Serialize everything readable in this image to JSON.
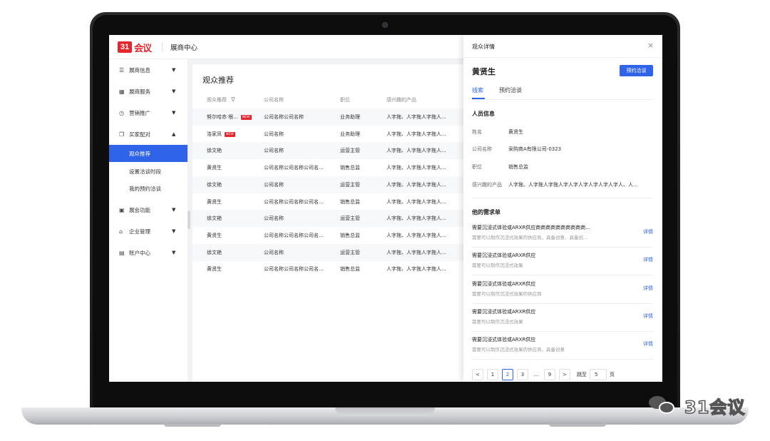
{
  "header": {
    "logo_mark": "31",
    "logo_text": "会议",
    "title": "展商中心"
  },
  "sidebar": {
    "items": [
      {
        "icon": "info-card-icon",
        "glyph": "☰",
        "label": "展商信息",
        "caret": "▼"
      },
      {
        "icon": "grid-icon",
        "glyph": "▦",
        "label": "展商服务",
        "caret": "▼"
      },
      {
        "icon": "clock-icon",
        "glyph": "◷",
        "label": "营销推广",
        "caret": "▼"
      },
      {
        "icon": "copy-icon",
        "glyph": "❐",
        "label": "买家配对",
        "caret": "▲"
      },
      {
        "icon": "meeting-icon",
        "glyph": "▣",
        "label": "展会功能",
        "caret": "▼"
      },
      {
        "icon": "building-icon",
        "glyph": "⌂",
        "label": "企业管理",
        "caret": "▼"
      },
      {
        "icon": "account-icon",
        "glyph": "▤",
        "label": "账户中心",
        "caret": "▼"
      }
    ],
    "sub_items": [
      {
        "label": "观众推荐",
        "active": true
      },
      {
        "label": "设置洽谈时段",
        "active": false
      },
      {
        "label": "我的预约洽谈",
        "active": false
      }
    ]
  },
  "main": {
    "title": "观众推荐",
    "columns": [
      "观众推荐",
      "公司名称",
      "职位",
      "感兴趣的产品"
    ],
    "filter_icon": "∇",
    "new_badge": "NEW",
    "rows": [
      {
        "name": "努尔哈赤·根...",
        "company": "公司名称公司名称",
        "title": "业务助理",
        "interest": "人字拖、人字拖人字拖人...",
        "new": true
      },
      {
        "name": "洛家凤",
        "company": "公司名称",
        "title": "业务助理",
        "interest": "人字拖、人字拖人字拖人...",
        "new": true
      },
      {
        "name": "徐文艳",
        "company": "公司名称",
        "title": "运营主管",
        "interest": "人字拖、人字拖人字拖人...",
        "new": false
      },
      {
        "name": "黄贤生",
        "company": "公司名称公司名称公司名...",
        "title": "销售总监",
        "interest": "人字拖、人字拖人字拖人...",
        "new": false
      },
      {
        "name": "徐文艳",
        "company": "公司名称",
        "title": "运营主管",
        "interest": "人字拖、人字拖人字拖人...",
        "new": false
      },
      {
        "name": "黄贤生",
        "company": "公司名称公司名称公司名...",
        "title": "销售总监",
        "interest": "人字拖、人字拖人字拖人...",
        "new": false
      },
      {
        "name": "徐文艳",
        "company": "公司名称",
        "title": "运营主管",
        "interest": "人字拖、人字拖人字拖人...",
        "new": false
      },
      {
        "name": "黄贤生",
        "company": "公司名称公司名称公司名...",
        "title": "销售总监",
        "interest": "人字拖、人字拖人字拖人...",
        "new": false
      },
      {
        "name": "徐文艳",
        "company": "公司名称",
        "title": "运营主管",
        "interest": "人字拖、人字拖人字拖人...",
        "new": false
      },
      {
        "name": "黄贤生",
        "company": "公司名称公司名称公司名...",
        "title": "销售总监",
        "interest": "人字拖、人字拖人字拖人...",
        "new": false
      }
    ]
  },
  "drawer": {
    "title": "观众详情",
    "close": "×",
    "name": "黄贤生",
    "book_button": "预约洽谈",
    "tabs": [
      {
        "label": "线索",
        "active": true
      },
      {
        "label": "预约洽谈",
        "active": false
      }
    ],
    "info_title": "人员信息",
    "info": [
      {
        "k": "姓名",
        "v": "黄贤生"
      },
      {
        "k": "公司名称",
        "v": "采购商A有限公司-0323"
      },
      {
        "k": "职位",
        "v": "销售总监"
      },
      {
        "k": "感兴趣的产品",
        "v": "人字拖、人字拖人字拖人字人字人字人字人字人字人、人..."
      }
    ],
    "needs_title": "他的需求单",
    "needs": [
      {
        "title": "需要沉浸式体验或ARXR供应商商商商商商商商商商...",
        "desc": "需要可以制作沉浸式效果的供应商，具备创意、具备创...",
        "link": "详情"
      },
      {
        "title": "需要沉浸式体验或ARXR供应",
        "desc": "需要可以制作沉浸式效果",
        "link": "详情"
      },
      {
        "title": "需要沉浸式体验或ARXR供应",
        "desc": "需要可以制作沉浸式效果的供应商",
        "link": "详情"
      },
      {
        "title": "需要沉浸式体验或ARXR供应",
        "desc": "需要可以制作沉浸式效果",
        "link": "详情"
      },
      {
        "title": "需要沉浸式体验或ARXR供应",
        "desc": "需要可以制作沉浸式效果的供应商，具备创意",
        "link": "详情"
      }
    ],
    "pager": {
      "prev": "<",
      "pages": [
        "1",
        "2",
        "3",
        "...",
        "9"
      ],
      "current": "2",
      "next": ">",
      "goto_label": "跳至",
      "goto_value": "5",
      "page_suffix": "页"
    }
  },
  "watermark": {
    "text": "31会议"
  }
}
